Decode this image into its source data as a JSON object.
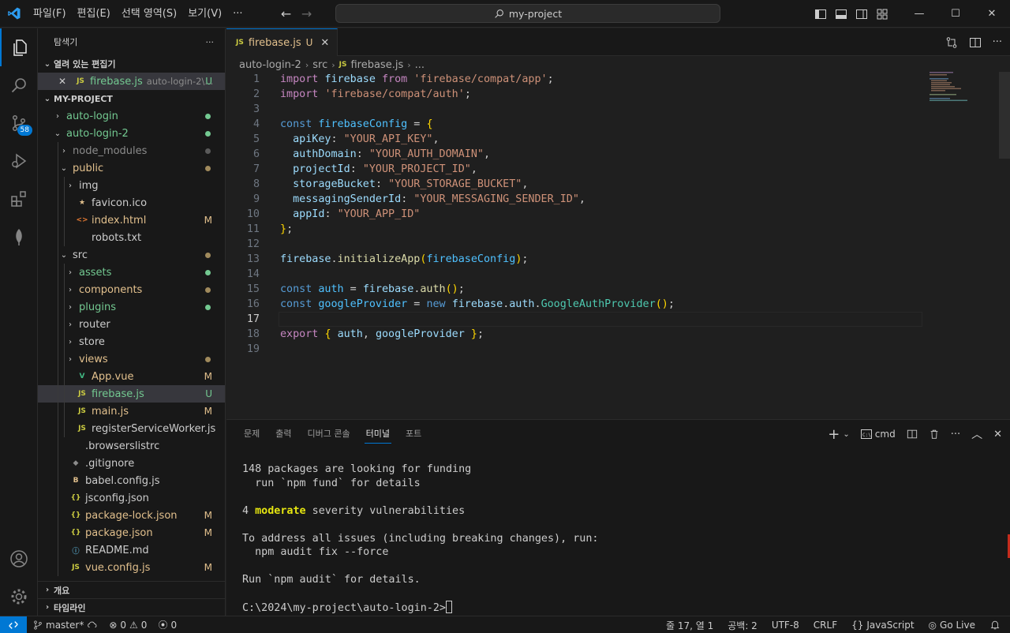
{
  "menu": [
    "파일(F)",
    "편집(E)",
    "선택 영역(S)",
    "보기(V)",
    "···"
  ],
  "command_center": {
    "text": "my-project"
  },
  "activity": {
    "scm_badge": "58"
  },
  "sidebar": {
    "header": "탐색기",
    "more": "···",
    "open_editors_title": "열려 있는 편집기",
    "open_editor": {
      "name": "firebase.js",
      "path": "auto-login-2\\...",
      "status": "U"
    },
    "project_title": "MY-PROJECT",
    "bottom_sections": [
      "개요",
      "타임라인"
    ]
  },
  "tree": [
    {
      "label": "auto-login",
      "depth": 0,
      "type": "folder",
      "open": false,
      "color": "green",
      "deco": "dot-green"
    },
    {
      "label": "auto-login-2",
      "depth": 0,
      "type": "folder",
      "open": true,
      "color": "green",
      "deco": "dot-green"
    },
    {
      "label": "node_modules",
      "depth": 1,
      "type": "folder",
      "open": false,
      "color": "dim",
      "deco": "dot-dim"
    },
    {
      "label": "public",
      "depth": 1,
      "type": "folder",
      "open": true,
      "color": "yellow",
      "deco": "dot-yellow"
    },
    {
      "label": "img",
      "depth": 2,
      "type": "folder",
      "open": false,
      "color": "plain",
      "deco": ""
    },
    {
      "label": "favicon.ico",
      "depth": 2,
      "type": "file",
      "icon": "star",
      "color": "plain",
      "deco": ""
    },
    {
      "label": "index.html",
      "depth": 2,
      "type": "file",
      "icon": "html",
      "color": "yellow",
      "deco": "M"
    },
    {
      "label": "robots.txt",
      "depth": 2,
      "type": "file",
      "icon": "none",
      "color": "plain",
      "deco": ""
    },
    {
      "label": "src",
      "depth": 1,
      "type": "folder",
      "open": true,
      "color": "plain",
      "deco": "dot-yellow"
    },
    {
      "label": "assets",
      "depth": 2,
      "type": "folder",
      "open": false,
      "color": "green",
      "deco": "dot-green"
    },
    {
      "label": "components",
      "depth": 2,
      "type": "folder",
      "open": false,
      "color": "yellow",
      "deco": "dot-yellow"
    },
    {
      "label": "plugins",
      "depth": 2,
      "type": "folder",
      "open": false,
      "color": "green",
      "deco": "dot-green"
    },
    {
      "label": "router",
      "depth": 2,
      "type": "folder",
      "open": false,
      "color": "plain",
      "deco": ""
    },
    {
      "label": "store",
      "depth": 2,
      "type": "folder",
      "open": false,
      "color": "plain",
      "deco": ""
    },
    {
      "label": "views",
      "depth": 2,
      "type": "folder",
      "open": false,
      "color": "yellow",
      "deco": "dot-yellow"
    },
    {
      "label": "App.vue",
      "depth": 2,
      "type": "file",
      "icon": "vue",
      "color": "yellow",
      "deco": "M"
    },
    {
      "label": "firebase.js",
      "depth": 2,
      "type": "file",
      "icon": "js",
      "color": "green",
      "deco": "U",
      "selected": true
    },
    {
      "label": "main.js",
      "depth": 2,
      "type": "file",
      "icon": "js",
      "color": "yellow",
      "deco": "M"
    },
    {
      "label": "registerServiceWorker.js",
      "depth": 2,
      "type": "file",
      "icon": "js",
      "color": "plain",
      "deco": ""
    },
    {
      "label": ".browserslistrc",
      "depth": 1,
      "type": "file",
      "icon": "none",
      "color": "plain",
      "deco": ""
    },
    {
      "label": ".gitignore",
      "depth": 1,
      "type": "file",
      "icon": "git",
      "color": "plain",
      "deco": ""
    },
    {
      "label": "babel.config.js",
      "depth": 1,
      "type": "file",
      "icon": "babel",
      "color": "plain",
      "deco": ""
    },
    {
      "label": "jsconfig.json",
      "depth": 1,
      "type": "file",
      "icon": "json",
      "color": "plain",
      "deco": ""
    },
    {
      "label": "package-lock.json",
      "depth": 1,
      "type": "file",
      "icon": "json",
      "color": "yellow",
      "deco": "M"
    },
    {
      "label": "package.json",
      "depth": 1,
      "type": "file",
      "icon": "json",
      "color": "yellow",
      "deco": "M"
    },
    {
      "label": "README.md",
      "depth": 1,
      "type": "file",
      "icon": "info",
      "color": "plain",
      "deco": ""
    },
    {
      "label": "vue.config.js",
      "depth": 1,
      "type": "file",
      "icon": "js",
      "color": "yellow",
      "deco": "M"
    }
  ],
  "editor": {
    "tab": {
      "icon": "JS",
      "name": "firebase.js",
      "status": "U",
      "close": "✕"
    },
    "breadcrumb": [
      "auto-login-2",
      "src",
      "firebase.js",
      "..."
    ],
    "current_line": 17,
    "lines": [
      [
        [
          "kw",
          "import"
        ],
        [
          "pl",
          " "
        ],
        [
          "id",
          "firebase"
        ],
        [
          "pl",
          " "
        ],
        [
          "kw",
          "from"
        ],
        [
          "pl",
          " "
        ],
        [
          "str",
          "'firebase/compat/app'"
        ],
        [
          "pl",
          ";"
        ]
      ],
      [
        [
          "kw",
          "import"
        ],
        [
          "pl",
          " "
        ],
        [
          "str",
          "'firebase/compat/auth'"
        ],
        [
          "pl",
          ";"
        ]
      ],
      [],
      [
        [
          "kw2",
          "const"
        ],
        [
          "pl",
          " "
        ],
        [
          "cn",
          "firebaseConfig"
        ],
        [
          "pl",
          " = "
        ],
        [
          "br1",
          "{"
        ]
      ],
      [
        [
          "pl",
          "  "
        ],
        [
          "id",
          "apiKey"
        ],
        [
          "pl",
          ": "
        ],
        [
          "str",
          "\"YOUR_API_KEY\""
        ],
        [
          "pl",
          ","
        ]
      ],
      [
        [
          "pl",
          "  "
        ],
        [
          "id",
          "authDomain"
        ],
        [
          "pl",
          ": "
        ],
        [
          "str",
          "\"YOUR_AUTH_DOMAIN\""
        ],
        [
          "pl",
          ","
        ]
      ],
      [
        [
          "pl",
          "  "
        ],
        [
          "id",
          "projectId"
        ],
        [
          "pl",
          ": "
        ],
        [
          "str",
          "\"YOUR_PROJECT_ID\""
        ],
        [
          "pl",
          ","
        ]
      ],
      [
        [
          "pl",
          "  "
        ],
        [
          "id",
          "storageBucket"
        ],
        [
          "pl",
          ": "
        ],
        [
          "str",
          "\"YOUR_STORAGE_BUCKET\""
        ],
        [
          "pl",
          ","
        ]
      ],
      [
        [
          "pl",
          "  "
        ],
        [
          "id",
          "messagingSenderId"
        ],
        [
          "pl",
          ": "
        ],
        [
          "str",
          "\"YOUR_MESSAGING_SENDER_ID\""
        ],
        [
          "pl",
          ","
        ]
      ],
      [
        [
          "pl",
          "  "
        ],
        [
          "id",
          "appId"
        ],
        [
          "pl",
          ": "
        ],
        [
          "str",
          "\"YOUR_APP_ID\""
        ]
      ],
      [
        [
          "br1",
          "}"
        ],
        [
          "pl",
          ";"
        ]
      ],
      [],
      [
        [
          "id",
          "firebase"
        ],
        [
          "pl",
          "."
        ],
        [
          "fn",
          "initializeApp"
        ],
        [
          "br1",
          "("
        ],
        [
          "cn",
          "firebaseConfig"
        ],
        [
          "br1",
          ")"
        ],
        [
          "pl",
          ";"
        ]
      ],
      [],
      [
        [
          "kw2",
          "const"
        ],
        [
          "pl",
          " "
        ],
        [
          "cn",
          "auth"
        ],
        [
          "pl",
          " = "
        ],
        [
          "id",
          "firebase"
        ],
        [
          "pl",
          "."
        ],
        [
          "fn",
          "auth"
        ],
        [
          "br1",
          "()"
        ],
        [
          "pl",
          ";"
        ]
      ],
      [
        [
          "kw2",
          "const"
        ],
        [
          "pl",
          " "
        ],
        [
          "cn",
          "googleProvider"
        ],
        [
          "pl",
          " = "
        ],
        [
          "kw2",
          "new"
        ],
        [
          "pl",
          " "
        ],
        [
          "id",
          "firebase"
        ],
        [
          "pl",
          "."
        ],
        [
          "id",
          "auth"
        ],
        [
          "pl",
          "."
        ],
        [
          "cls",
          "GoogleAuthProvider"
        ],
        [
          "br1",
          "()"
        ],
        [
          "pl",
          ";"
        ]
      ],
      [],
      [
        [
          "kw",
          "export"
        ],
        [
          "pl",
          " "
        ],
        [
          "br1",
          "{"
        ],
        [
          "pl",
          " "
        ],
        [
          "id",
          "auth"
        ],
        [
          "pl",
          ", "
        ],
        [
          "id",
          "googleProvider"
        ],
        [
          "pl",
          " "
        ],
        [
          "br1",
          "}"
        ],
        [
          "pl",
          ";"
        ]
      ],
      []
    ]
  },
  "panel": {
    "tabs": [
      "문제",
      "출력",
      "디버그 콘솔",
      "터미널",
      "포트"
    ],
    "active_tab": 3,
    "terminal_name": "cmd",
    "terminal_lines": [
      [
        [
          "n",
          "148 packages are looking for funding"
        ]
      ],
      [
        [
          "n",
          "  run `npm fund` for details"
        ]
      ],
      [],
      [
        [
          "n",
          "4 "
        ],
        [
          "b",
          "moderate"
        ],
        [
          "n",
          " severity vulnerabilities"
        ]
      ],
      [],
      [
        [
          "n",
          "To address all issues (including breaking changes), run:"
        ]
      ],
      [
        [
          "n",
          "  npm audit fix --force"
        ]
      ],
      [],
      [
        [
          "n",
          "Run `npm audit` for details."
        ]
      ],
      [],
      [
        [
          "n",
          "C:\\2024\\my-project\\auto-login-2>"
        ]
      ]
    ]
  },
  "status": {
    "branch": "master*",
    "errors": "0",
    "warnings": "0",
    "ports": "0",
    "position": "줄 17, 열 1",
    "indent": "공백: 2",
    "encoding": "UTF-8",
    "eol": "CRLF",
    "language": "JavaScript",
    "golive": "Go Live",
    "language_icon": "{}"
  },
  "colors": {
    "accent": "#0078d4",
    "bg": "#1f1f1f",
    "sidebar_bg": "#181818"
  }
}
